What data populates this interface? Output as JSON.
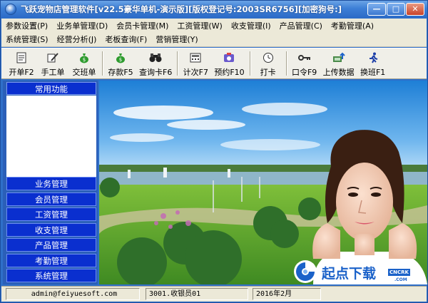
{
  "window": {
    "title": "飞跃宠物店管理软件[v22.5豪华单机-演示版][版权登记号:2003SR6756][加密狗号:]",
    "controls": {
      "minimize": "—",
      "maximize": "□",
      "close": "✕"
    }
  },
  "menu": {
    "row1": [
      "参数设置(P)",
      "业务单管理(D)",
      "会员卡管理(M)",
      "工资管理(W)",
      "收支管理(I)",
      "产品管理(C)",
      "考勤管理(A)"
    ],
    "row2": [
      "系统管理(S)",
      "经营分析(J)",
      "老板查询(F)",
      "营销管理(Y)"
    ]
  },
  "toolbar": [
    {
      "label": "开单F2",
      "icon": "document-icon",
      "glyph": "🗎"
    },
    {
      "label": "手工单",
      "icon": "handwrite-icon",
      "glyph": "✍"
    },
    {
      "label": "交班单",
      "icon": "money-bag-icon",
      "glyph": "💰"
    },
    {
      "label": "存款F5",
      "icon": "deposit-icon",
      "glyph": "💰"
    },
    {
      "label": "查询卡F6",
      "icon": "binoculars-icon",
      "glyph": "🔭"
    },
    {
      "label": "计次F7",
      "icon": "counter-icon",
      "glyph": "▦"
    },
    {
      "label": "预约F10",
      "icon": "appointment-icon",
      "glyph": "☎"
    },
    {
      "label": "打卡",
      "icon": "clock-icon",
      "glyph": "🕒"
    },
    {
      "label": "口令F9",
      "icon": "key-icon",
      "glyph": "⚿"
    },
    {
      "label": "上传数据",
      "icon": "upload-icon",
      "glyph": "⇪"
    },
    {
      "label": "换班F1",
      "icon": "shift-runner-icon",
      "glyph": "🏃"
    }
  ],
  "leftpanel": {
    "header": "常用功能",
    "items": [
      "业务管理",
      "会员管理",
      "工资管理",
      "收支管理",
      "产品管理",
      "考勤管理",
      "系统管理"
    ]
  },
  "statusbar": {
    "email": "admin@feiyuesoft.com",
    "cashier": "3001.收银员01",
    "date": "2016年2月"
  },
  "watermark": {
    "brand": "起点下载",
    "tag": "CNCRK",
    "domain": ".COM"
  }
}
